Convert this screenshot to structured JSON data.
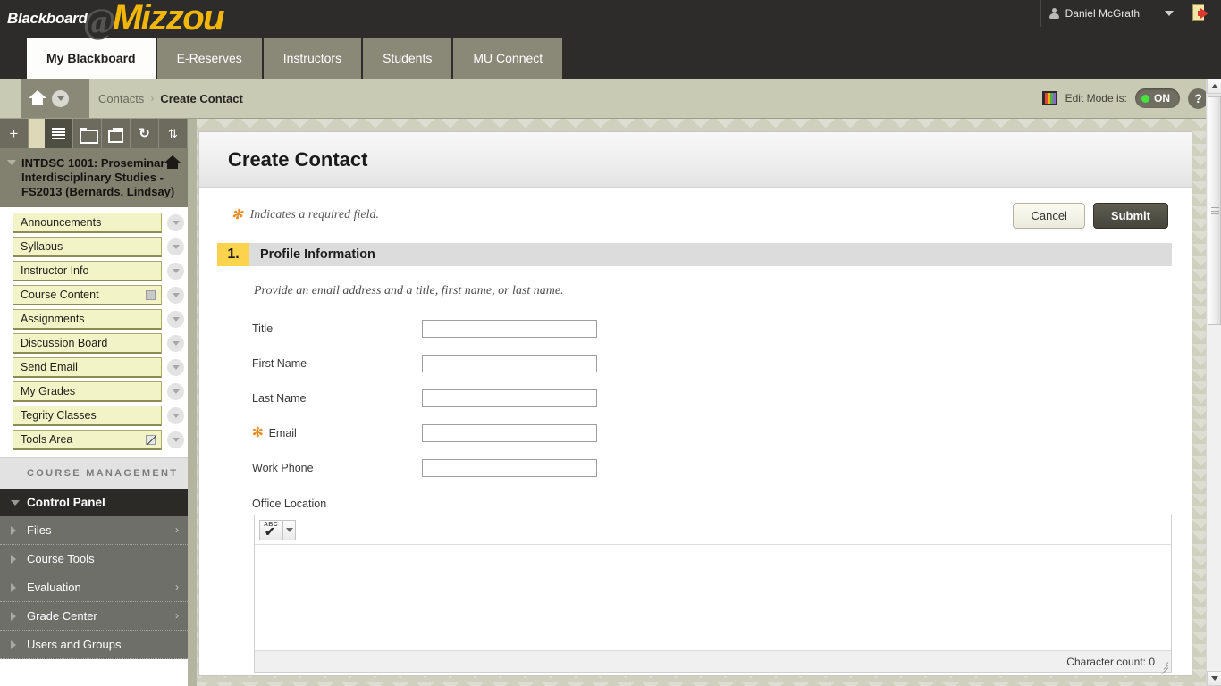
{
  "header": {
    "logo_blackboard": "Blackboard",
    "logo_at": "@",
    "logo_mizzou": "Mizzou",
    "user_name": "Daniel McGrath",
    "user_icon": "person-icon",
    "caret_icon": "chevron-down-icon",
    "logout_icon": "logout-door-icon"
  },
  "tabs": [
    {
      "label": "My Blackboard",
      "active": true
    },
    {
      "label": "E-Reserves",
      "active": false
    },
    {
      "label": "Instructors",
      "active": false
    },
    {
      "label": "Students",
      "active": false
    },
    {
      "label": "MU Connect",
      "active": false
    }
  ],
  "breadcrumb": {
    "home_icon": "home-icon",
    "dropdown_icon": "chevron-down-circle-icon",
    "parent": "Contacts",
    "separator": "›",
    "current": "Create Contact"
  },
  "edit_mode": {
    "palette_icon": "color-palette-icon",
    "label": "Edit Mode is:",
    "toggle_state": "ON",
    "toggle_color": "#46e43b",
    "help_label": "?"
  },
  "sidebar": {
    "toolbar": [
      {
        "name": "add-icon",
        "glyph": "+"
      },
      {
        "name": "list-view-icon",
        "glyph": "list"
      },
      {
        "name": "folder-view-icon",
        "glyph": "folder"
      },
      {
        "name": "display-view-icon",
        "glyph": "window"
      },
      {
        "name": "refresh-icon",
        "glyph": "↻"
      },
      {
        "name": "reorder-icon",
        "glyph": "⇅"
      }
    ],
    "course_title": "INTDSC 1001: Proseminar in Interdisciplinary Studies - FS2013 (Bernards, Lindsay)",
    "menu_items": [
      {
        "label": "Announcements",
        "badge": null
      },
      {
        "label": "Syllabus",
        "badge": null
      },
      {
        "label": "Instructor Info",
        "badge": null
      },
      {
        "label": "Course Content",
        "badge": "grid"
      },
      {
        "label": "Assignments",
        "badge": null
      },
      {
        "label": "Discussion Board",
        "badge": null
      },
      {
        "label": "Send Email",
        "badge": null
      },
      {
        "label": "My Grades",
        "badge": null
      },
      {
        "label": "Tegrity Classes",
        "badge": null
      },
      {
        "label": "Tools Area",
        "badge": "unavailable"
      }
    ],
    "course_management_header": "COURSE MANAGEMENT",
    "control_panel_label": "Control Panel",
    "control_panel_items": [
      {
        "label": "Files",
        "has_arrow": true
      },
      {
        "label": "Course Tools",
        "has_arrow": false
      },
      {
        "label": "Evaluation",
        "has_arrow": true
      },
      {
        "label": "Grade Center",
        "has_arrow": true
      },
      {
        "label": "Users and Groups",
        "has_arrow": false
      }
    ]
  },
  "main": {
    "page_title": "Create Contact",
    "required_note": "Indicates a required field.",
    "required_asterisk": "✻",
    "cancel_label": "Cancel",
    "submit_label": "Submit",
    "section": {
      "number": "1.",
      "title": "Profile Information",
      "description": "Provide an email address and a title, first name, or last name."
    },
    "fields": [
      {
        "label": "Title",
        "value": "",
        "required": false
      },
      {
        "label": "First Name",
        "value": "",
        "required": false
      },
      {
        "label": "Last Name",
        "value": "",
        "required": false
      },
      {
        "label": "Email",
        "value": "",
        "required": true
      },
      {
        "label": "Work Phone",
        "value": "",
        "required": false
      }
    ],
    "office_location": {
      "label": "Office Location",
      "spellcheck_icon": "spellcheck-abc-icon",
      "spellcheck_text": "ABC",
      "spellcheck_glyph": "✔",
      "dropdown_icon": "chevron-down-icon",
      "value": "",
      "character_count_label": "Character count: 0"
    }
  },
  "colors": {
    "brand_gold": "#f2b705",
    "topbar_dark": "#2e2c2a",
    "tab_inactive": "#8a8877",
    "sage_bg": "#cfd0bd",
    "menu_yellow": "#f3f3c8",
    "section_gold": "#fbd34d",
    "required_orange": "#e8912c"
  }
}
